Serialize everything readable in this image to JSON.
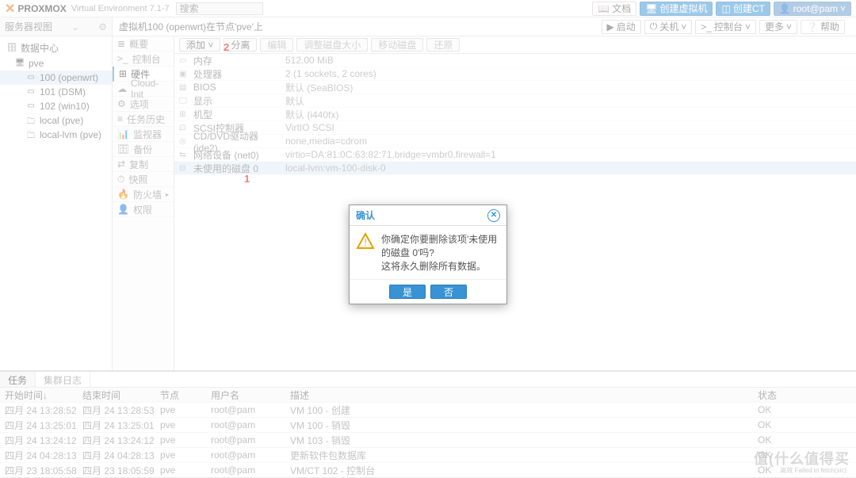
{
  "app": {
    "brand": "PROXMOX",
    "ve": "Virtual Environment 7.1-7",
    "search_ph": "搜索"
  },
  "top_btns": {
    "docs": "文档",
    "create_vm": "创建虚拟机",
    "create_ct": "创建CT",
    "user": "root@pam"
  },
  "left_header": "服务器视图",
  "tree": [
    {
      "lvl": 0,
      "icon": "🗄",
      "label": "数据中心"
    },
    {
      "lvl": 1,
      "icon": "🖥",
      "label": "pve",
      "sel": true
    },
    {
      "lvl": 2,
      "icon": "▭",
      "label": "100 (openwrt)",
      "hl": true
    },
    {
      "lvl": 2,
      "icon": "▭",
      "label": "101 (DSM)"
    },
    {
      "lvl": 2,
      "icon": "▭",
      "label": "102 (win10)"
    },
    {
      "lvl": 2,
      "icon": "🗀",
      "label": "local (pve)"
    },
    {
      "lvl": 2,
      "icon": "🗀",
      "label": "local-lvm (pve)"
    }
  ],
  "breadcrumb": "虚拟机100 (openwrt)在节点'pve'上",
  "crumb_actions": {
    "start": "启动",
    "shutdown": "关机",
    "console": "控制台",
    "more": "更多",
    "help": "帮助"
  },
  "vtabs": [
    {
      "icon": "≣",
      "label": "概要"
    },
    {
      "icon": ">_",
      "label": "控制台"
    },
    {
      "icon": "⊞",
      "label": "硬件",
      "act": true
    },
    {
      "icon": "☁",
      "label": "Cloud-Init"
    },
    {
      "icon": "⚙",
      "label": "选项"
    },
    {
      "icon": "≡",
      "label": "任务历史"
    },
    {
      "icon": "📊",
      "label": "监视器"
    },
    {
      "icon": "🗄",
      "label": "备份"
    },
    {
      "icon": "⇄",
      "label": "复制"
    },
    {
      "icon": "⏱",
      "label": "快照"
    },
    {
      "icon": "🔥",
      "label": "防火墙",
      "arr": "▸"
    },
    {
      "icon": "👤",
      "label": "权限"
    }
  ],
  "toolbar": {
    "add": "添加",
    "detach": "分离",
    "edit": "编辑",
    "resize": "调整磁盘大小",
    "move": "移动磁盘",
    "remove": "还原"
  },
  "hw": [
    {
      "icon": "▭",
      "label": "内存",
      "val": "512.00 MiB"
    },
    {
      "icon": "▣",
      "label": "处理器",
      "val": "2 (1 sockets, 2 cores)"
    },
    {
      "icon": "▤",
      "label": "BIOS",
      "val": "默认 (SeaBIOS)"
    },
    {
      "icon": "🖵",
      "label": "显示",
      "val": "默认"
    },
    {
      "icon": "⊞",
      "label": "机型",
      "val": "默认 (i440fx)"
    },
    {
      "icon": "⊡",
      "label": "SCSI控制器",
      "val": "VirtIO SCSI"
    },
    {
      "icon": "◎",
      "label": "CD/DVD驱动器 (ide2)",
      "val": "none,media=cdrom"
    },
    {
      "icon": "⇆",
      "label": "网络设备 (net0)",
      "val": "virtio=DA:81:0C:63:82:71,bridge=vmbr0,firewall=1"
    },
    {
      "icon": "⊟",
      "label": "未使用的磁盘 0",
      "val": "local-lvm:vm-100-disk-0",
      "sel": true
    }
  ],
  "annot": {
    "r1": "1",
    "r2": "2"
  },
  "dialog": {
    "title": "确认",
    "msg1": "你确定你要删除该项'未使用的磁盘 0'吗?",
    "msg2": "这将永久删除所有数据。",
    "yes": "是",
    "no": "否"
  },
  "log": {
    "tabs": {
      "tasks": "任务",
      "cluster": "集群日志"
    },
    "cols": {
      "start": "开始时间↓",
      "end": "结束时间",
      "node": "节点",
      "user": "用户名",
      "desc": "描述",
      "status": "状态"
    },
    "rows": [
      {
        "s": "四月 24 13:28:52",
        "e": "四月 24 13:28:53",
        "n": "pve",
        "u": "root@pam",
        "d": "VM 100 - 创建",
        "st": "OK"
      },
      {
        "s": "四月 24 13:25:01",
        "e": "四月 24 13:25:01",
        "n": "pve",
        "u": "root@pam",
        "d": "VM 100 - 销毁",
        "st": "OK"
      },
      {
        "s": "四月 24 13:24:12",
        "e": "四月 24 13:24:12",
        "n": "pve",
        "u": "root@pam",
        "d": "VM 103 - 销毁",
        "st": "OK"
      },
      {
        "s": "四月 24 04:28:13",
        "e": "四月 24 04:28:13",
        "n": "pve",
        "u": "root@pam",
        "d": "更新软件包数据库",
        "st": "OK"
      },
      {
        "s": "四月 23 18:05:58",
        "e": "四月 23 18:05:59",
        "n": "pve",
        "u": "root@pam",
        "d": "VM/CT 102 - 控制台",
        "st": "OK"
      }
    ]
  },
  "watermark": {
    "main": "值(什么值得买",
    "sub": "高效 Failed to fetch(sic)"
  }
}
